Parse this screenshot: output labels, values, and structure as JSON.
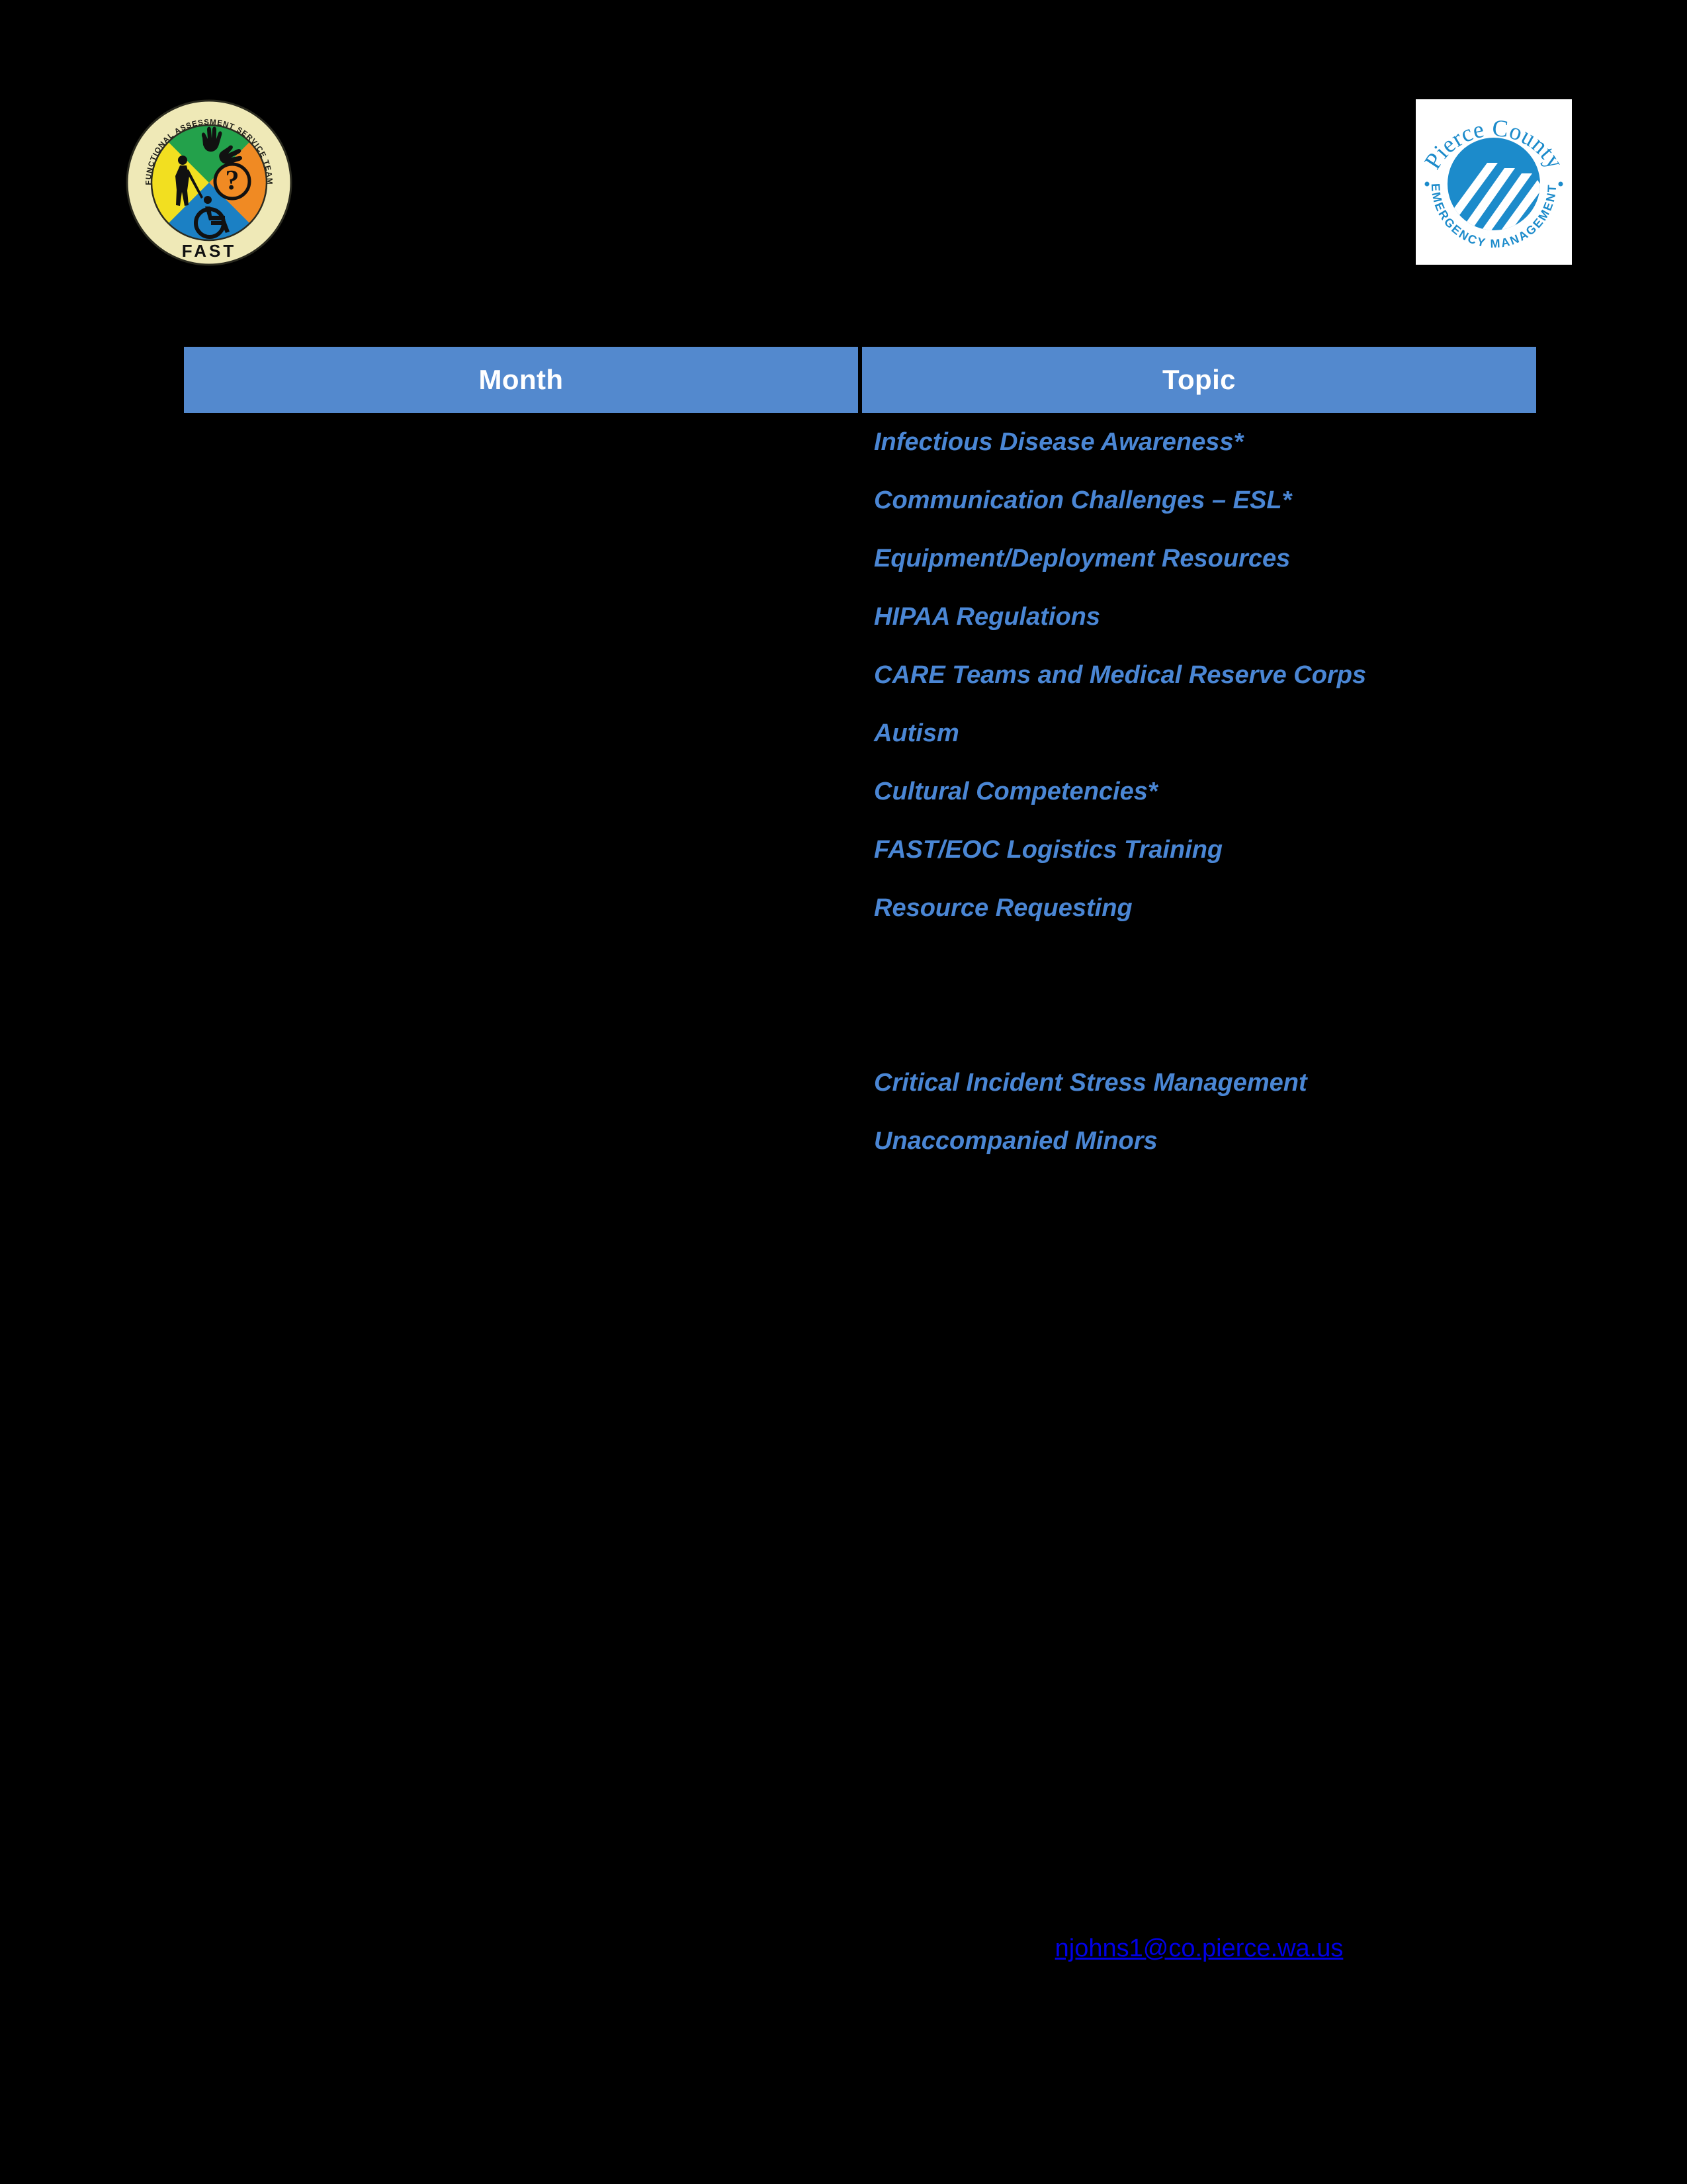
{
  "page": {
    "background_color": "#000000",
    "accent_header_color": "#5389CE",
    "topic_text_color": "#4A86D4",
    "link_color": "#0000E6"
  },
  "logos": {
    "left": {
      "name": "fast-logo",
      "ring_text": "FUNCTIONAL ASSESSMENT SERVICE TEAM",
      "acronym": "FAST",
      "quadrant_colors": [
        "#F2DF20",
        "#23A14B",
        "#F08A23",
        "#1B80C4"
      ],
      "ring_color": "#EFE9B7"
    },
    "right": {
      "name": "pierce-county-emergency-management-logo",
      "top_text": "Pierce County",
      "bottom_text": "EMERGENCY MANAGEMENT",
      "mark_color": "#1C8BCB",
      "plate_color": "#FFFFFF"
    }
  },
  "table": {
    "columns": [
      "Month",
      "Topic"
    ],
    "rows": [
      {
        "month": "",
        "topic": "Infectious Disease Awareness*"
      },
      {
        "month": "",
        "topic": "Communication Challenges – ESL*"
      },
      {
        "month": "",
        "topic": "Equipment/Deployment Resources"
      },
      {
        "month": "",
        "topic": "HIPAA Regulations"
      },
      {
        "month": "",
        "topic": "CARE Teams and Medical Reserve Corps"
      },
      {
        "month": "",
        "topic": "Autism"
      },
      {
        "month": "",
        "topic": "Cultural Competencies*"
      },
      {
        "month": "",
        "topic": "FAST/EOC Logistics Training"
      },
      {
        "month": "",
        "topic": "Resource Requesting"
      },
      {
        "month": "",
        "topic": ""
      },
      {
        "month": "",
        "topic": ""
      },
      {
        "month": "",
        "topic": "Critical Incident Stress Management"
      },
      {
        "month": "",
        "topic": "Unaccompanied Minors"
      }
    ]
  },
  "contact": {
    "email": "njohns1@co.pierce.wa.us"
  }
}
